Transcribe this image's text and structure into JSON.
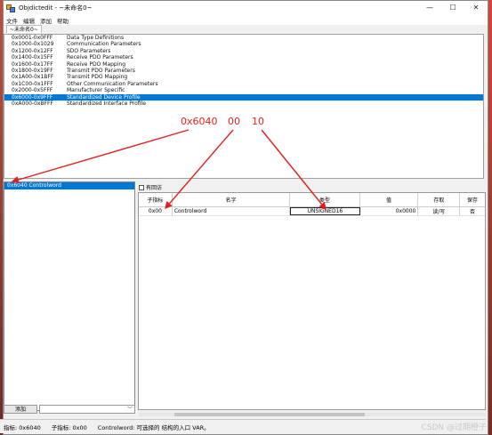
{
  "window": {
    "title": "Objdictedit - ~未命名0~",
    "controls": [
      "—",
      "☐",
      "✕"
    ]
  },
  "menu": [
    "文件",
    "编辑",
    "添加",
    "帮助"
  ],
  "tab": {
    "label": "~未命名0~"
  },
  "ranges": [
    {
      "range": "0x0001-0x0FFF",
      "label": "Data Type Definitions"
    },
    {
      "range": "0x1000-0x1029",
      "label": "Communication Parameters"
    },
    {
      "range": "0x1200-0x12FF",
      "label": "SDO Parameters"
    },
    {
      "range": "0x1400-0x15FF",
      "label": "Receive PDO Parameters"
    },
    {
      "range": "0x1600-0x17FF",
      "label": "Receive PDO Mapping"
    },
    {
      "range": "0x1800-0x19FF",
      "label": "Transmit PDO Parameters"
    },
    {
      "range": "0x1A00-0x1BFF",
      "label": "Transmit PDO Mapping"
    },
    {
      "range": "0x1C00-0x1FFF",
      "label": "Other Communication Parameters"
    },
    {
      "range": "0x2000-0x5FFF",
      "label": "Manufacturer Specific"
    },
    {
      "range": "0x6000-0x9FFF",
      "label": "Standardized Device Profile"
    },
    {
      "range": "0xA000-0xBFFF",
      "label": "Standardized Interface Profile"
    }
  ],
  "selected_range_index": 9,
  "left_list": [
    {
      "label": "0x6040   Controlword"
    }
  ],
  "add_button": "添加",
  "advanced_label": "有回访",
  "table": {
    "headers": [
      "子指标",
      "名字",
      "类型",
      "值",
      "存取",
      "保存"
    ],
    "rows": [
      [
        "0x00",
        "Controlword",
        "UNSIGNED16",
        "0x0000",
        "读/写",
        "否"
      ]
    ]
  },
  "annotations": [
    "0x6040",
    "00",
    "10"
  ],
  "status": {
    "index": "指标: 0x6040",
    "subindex": "子指标: 0x00",
    "description": "Controlword: 可选择的 结构的入口 VAR。"
  },
  "watermark": "CSDN @过期橙子",
  "colors": {
    "selection": "#0078d7",
    "annotation": "#e02020"
  }
}
